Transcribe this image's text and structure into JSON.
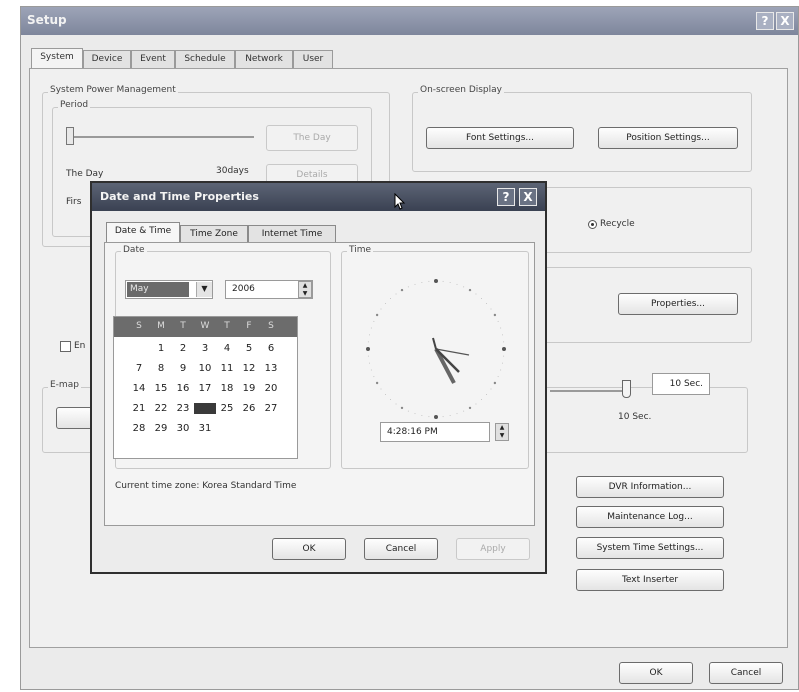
{
  "setup": {
    "title": "Setup",
    "help_label": "?",
    "close_label": "X",
    "tabs": [
      "System",
      "Device",
      "Event",
      "Schedule",
      "Network",
      "User"
    ],
    "power_group": "System Power Management",
    "period_group": "Period",
    "the_day_button": "The Day",
    "the_day_label": "The Day",
    "days_30": "30days",
    "details_button": "Details",
    "first_label": "Firs",
    "osd_group": "On-screen Display",
    "font_settings": "Font Settings...",
    "position_settings": "Position Settings...",
    "recycle_label": "Recycle",
    "properties_button": "Properties...",
    "enable_label": "En",
    "e_map_label": "E-map",
    "sec_field": "10 Sec.",
    "sec_label": "10 Sec.",
    "dvr_info": "DVR Information...",
    "maintenance_log": "Maintenance Log...",
    "system_time_settings": "System Time Settings...",
    "text_inserter": "Text Inserter",
    "ok": "OK",
    "cancel": "Cancel"
  },
  "dialog": {
    "title": "Date and Time Properties",
    "help_label": "?",
    "close_label": "X",
    "tabs": [
      "Date & Time",
      "Time Zone",
      "Internet Time"
    ],
    "date_group": "Date",
    "time_group": "Time",
    "month": "May",
    "year": "2006",
    "weekdays": [
      "S",
      "M",
      "T",
      "W",
      "T",
      "F",
      "S"
    ],
    "weeks": [
      [
        "",
        "1",
        "2",
        "3",
        "4",
        "5",
        "6"
      ],
      [
        "7",
        "8",
        "9",
        "10",
        "11",
        "12",
        "13"
      ],
      [
        "14",
        "15",
        "16",
        "17",
        "18",
        "19",
        "20"
      ],
      [
        "21",
        "22",
        "23",
        "24",
        "25",
        "26",
        "27"
      ],
      [
        "28",
        "29",
        "30",
        "31",
        "",
        "",
        ""
      ]
    ],
    "selected_day": "24",
    "time": "4:28:16 PM",
    "timezone_text": "Current time zone: Korea Standard Time",
    "ok": "OK",
    "cancel": "Cancel",
    "apply": "Apply"
  },
  "colors": {
    "title_bar": "#8c93a8",
    "dialog_title_bar": "#4a5163",
    "calendar_header": "#6c6c6c"
  }
}
